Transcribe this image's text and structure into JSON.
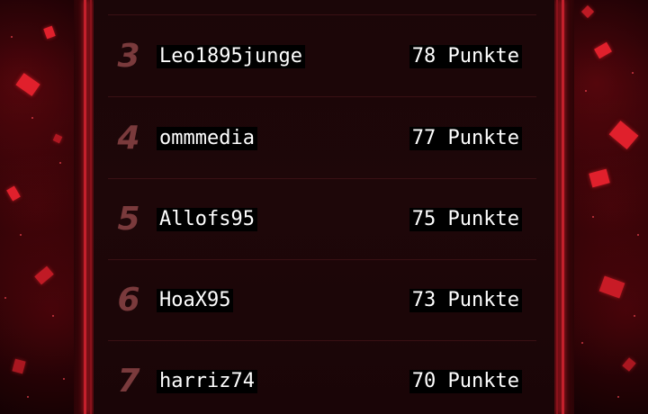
{
  "leaderboard": {
    "rows": [
      {
        "rank": "3",
        "name": "Leo1895junge",
        "points": "78 Punkte"
      },
      {
        "rank": "4",
        "name": "ommmedia",
        "points": "77 Punkte"
      },
      {
        "rank": "5",
        "name": "Allofs95",
        "points": "75 Punkte"
      },
      {
        "rank": "6",
        "name": "HoaX95",
        "points": "73 Punkte"
      },
      {
        "rank": "7",
        "name": "harriz74",
        "points": "70 Punkte"
      }
    ]
  },
  "colors": {
    "accent": "#c3202c",
    "rank_text": "#7a3a3c",
    "panel_bg": "#1b0608",
    "confetti": "#e0202c"
  }
}
